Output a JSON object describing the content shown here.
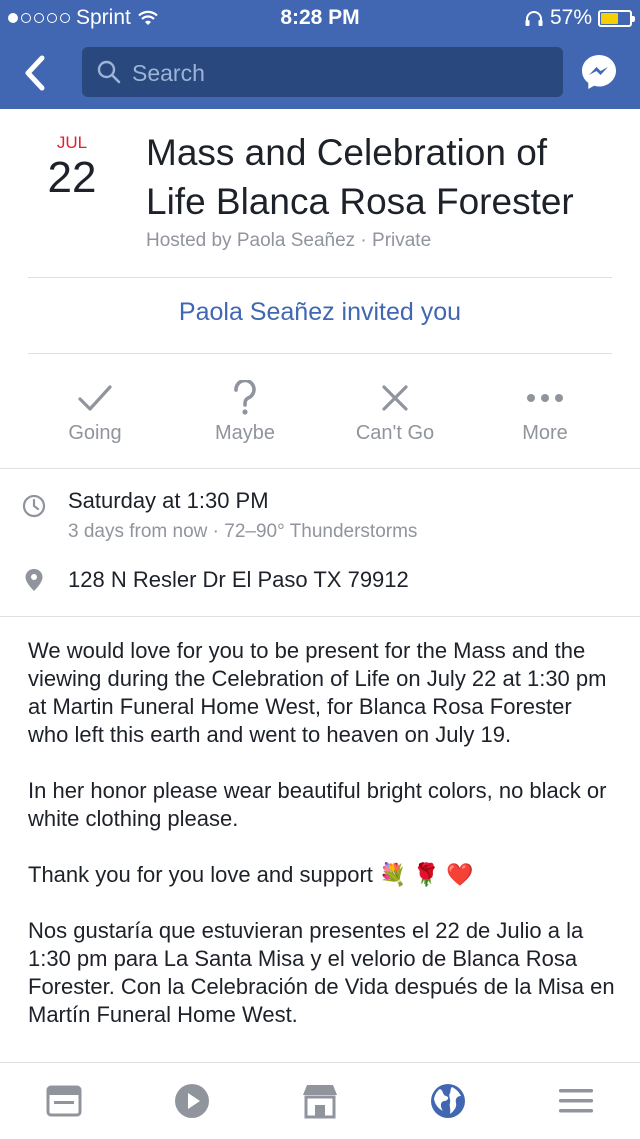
{
  "status": {
    "carrier": "Sprint",
    "time": "8:28 PM",
    "battery": "57%",
    "battery_fraction": 0.57
  },
  "search": {
    "placeholder": "Search"
  },
  "event": {
    "month": "JUL",
    "day": "22",
    "title": "Mass and Celebration of Life Blanca Rosa Forester",
    "hosted": "Hosted by Paola Seañez · Private",
    "invited": "Paola Seañez invited you"
  },
  "actions": {
    "going": "Going",
    "maybe": "Maybe",
    "cant_go": "Can't Go",
    "more": "More"
  },
  "details": {
    "time": "Saturday at 1:30 PM",
    "time_sub": "3 days from now · 72–90° Thunderstorms",
    "location": "128 N Resler Dr El Paso TX 79912"
  },
  "description": {
    "p1": "We would love for you to be present for the Mass and the viewing during the Celebration of Life on July 22 at 1:30 pm at Martin Funeral Home West, for Blanca Rosa Forester who left this earth and went to heaven on July 19.",
    "p2": "In her honor please wear beautiful bright colors, no black or white clothing please.",
    "p3": "Thank you for you love and support 💐 🌹 ❤️",
    "p4": "Nos gustaría que estuvieran presentes el 22 de Julio a la 1:30 pm para La Santa Misa y el velorio de Blanca Rosa Forester. Con la Celebración de Vida después de la Misa en Martín Funeral Home West."
  },
  "colors": {
    "brand": "#4267b2",
    "accent_red": "#e0222f",
    "muted": "#90949c"
  },
  "tabs": [
    "news-feed-icon",
    "video-icon",
    "marketplace-icon",
    "globe-icon",
    "menu-icon"
  ]
}
